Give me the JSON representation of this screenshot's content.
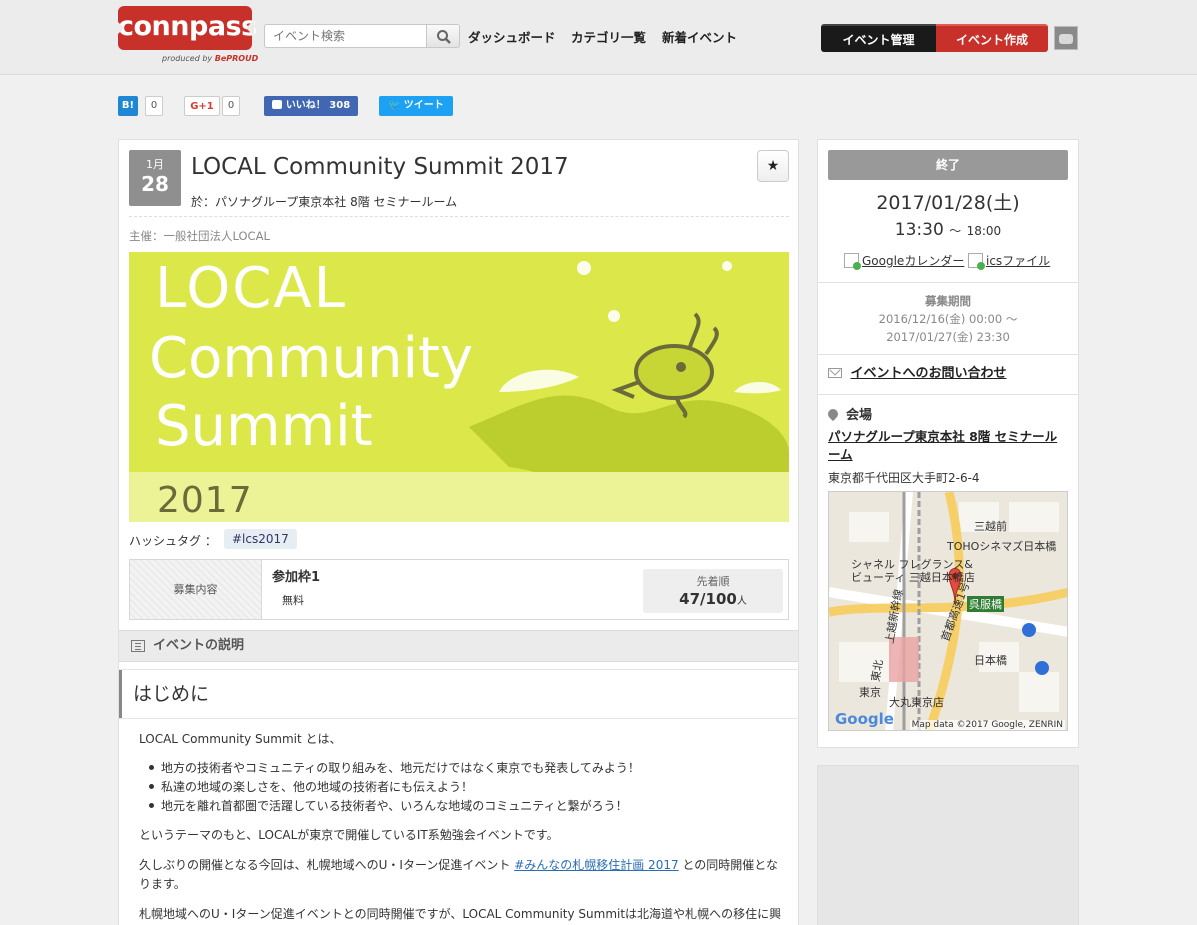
{
  "header": {
    "logo_text": "connpass",
    "logo_sub": "produced by",
    "logo_brand": "BePROUD",
    "search_placeholder": "イベント検索",
    "nav": [
      "ダッシュボード",
      "カテゴリ一覧",
      "新着イベント"
    ],
    "manage_label": "イベント管理",
    "create_label": "イベント作成"
  },
  "share": {
    "hatena_label": "B!",
    "hatena_count": "0",
    "gplus_label": "G+1",
    "gplus_count": "0",
    "like_label": "いいね！ 308",
    "tweet_label": "ツイート"
  },
  "event": {
    "month": "1月",
    "day": "28",
    "title": "LOCAL Community Summit 2017",
    "venue_line": "於：パソナグループ東京本社 8階 セミナールーム",
    "organizer": "主催：一般社団法人LOCAL",
    "banner": {
      "line1": "LOCAL",
      "line2": "Community",
      "line3": "Summit",
      "year": "2017"
    },
    "hashtag_label": "ハッシュタグ ：",
    "hashtag": "#lcs2017",
    "quota": {
      "label": "募集内容",
      "name": "参加枠1",
      "fee": "無料",
      "type": "先着順",
      "count": "47/100",
      "unit": "人"
    },
    "section_title": "イベントの説明",
    "h2": "はじめに",
    "intro": "LOCAL Community Summit とは、",
    "bullets": [
      "地方の技術者やコミュニティの取り組みを、地元だけではなく東京でも発表してみよう！",
      "私達の地域の楽しさを、他の地域の技術者にも伝えよう！",
      "地元を離れ首都圏で活躍している技術者や、いろんな地域のコミュニティと繋がろう！"
    ],
    "p2": "というテーマのもと、LOCALが東京で開催しているIT系勉強会イベントです。",
    "p3_a": "久しぶりの開催となる今回は、札幌地域へのU・Iターン促進イベント ",
    "p3_link": "#みんなの札幌移住計画 2017",
    "p3_b": " との同時開催とな",
    "p3_c": "ります。",
    "p4": "札幌地域へのU・Iターン促進イベントとの同時開催ですが、LOCAL Community Summitは北海道や札幌への移住に興"
  },
  "side": {
    "status": "終了",
    "date": "2017/01/28(土)",
    "time_start": "13:30",
    "time_sep": "〜",
    "time_end": "18:00",
    "gcal": "Googleカレンダー",
    "ics": "icsファイル",
    "recruit_title": "募集期間",
    "recruit_from": "2016/12/16(金) 00:00 〜",
    "recruit_to": "2017/01/27(金) 23:30",
    "contact": "イベントへのお問い合わせ",
    "venue_title": "会場",
    "venue_name": "パソナグループ東京本社 8階 セミナールーム",
    "address": "東京都千代田区大手町2-6-4",
    "map": {
      "labels": [
        "三越前",
        "TOHOシネマズ日本橋",
        "シャネル フレグランス&",
        "ビューティ 三越日本橋店",
        "呉服橋",
        "首都高速1号",
        "上越新幹線",
        "東北",
        "日本橋",
        "東京",
        "大丸東京店"
      ],
      "google": "Google",
      "attribution": "Map data ©2017 Google, ZENRIN"
    }
  }
}
